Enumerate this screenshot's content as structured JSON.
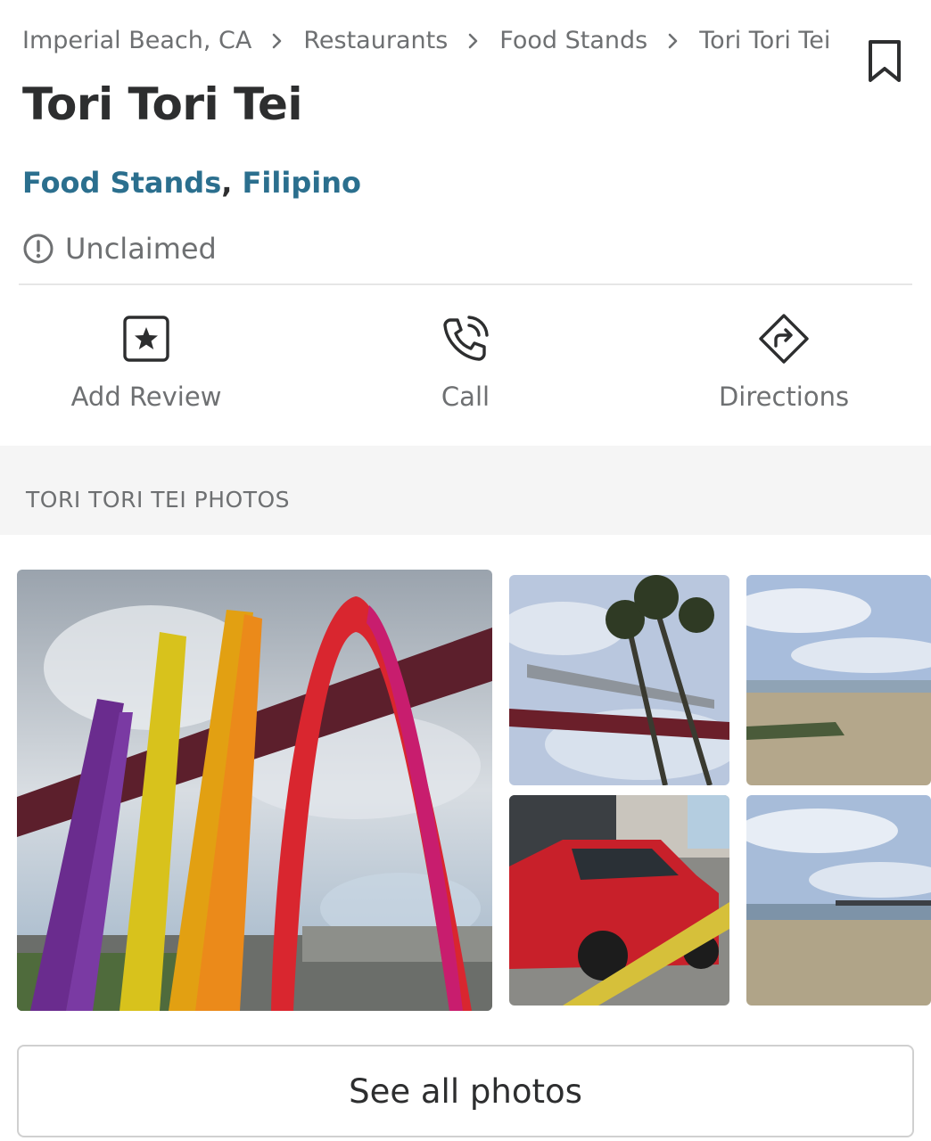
{
  "breadcrumb": {
    "items": [
      "Imperial Beach, CA",
      "Restaurants",
      "Food Stands",
      "Tori Tori Tei"
    ]
  },
  "business": {
    "name": "Tori Tori Tei",
    "categories": [
      "Food Stands",
      "Filipino"
    ],
    "category_separator": ",",
    "claim_status": "Unclaimed"
  },
  "actions": {
    "add_review": "Add Review",
    "call": "Call",
    "directions": "Directions"
  },
  "photos": {
    "header": "TORI TORI TEI PHOTOS",
    "items": [
      {
        "name": "rainbow-arches-sign-photo"
      },
      {
        "name": "imperial-beach-sign-palms-photo"
      },
      {
        "name": "beach-sand-sky-photo"
      },
      {
        "name": "lifeguard-truck-photo"
      },
      {
        "name": "beach-pier-photo"
      }
    ],
    "see_all_label": "See all photos"
  },
  "colors": {
    "link": "#2b6f8e",
    "text": "#2d2e2f",
    "muted": "#6e7072",
    "section_bg": "#f5f5f5"
  },
  "icons": [
    "chevron-right-icon",
    "bookmark-icon",
    "exclamation-circle-icon",
    "star-square-icon",
    "phone-icon",
    "directions-icon"
  ]
}
